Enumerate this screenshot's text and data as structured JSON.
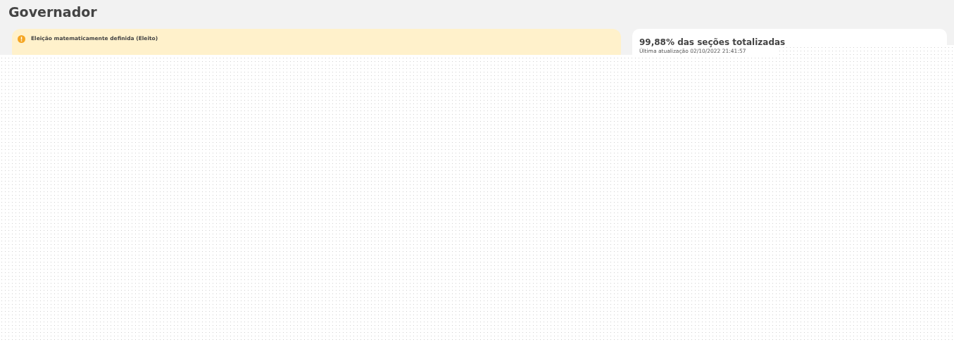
{
  "page_title": "Governador",
  "alert": {
    "kind": "warning",
    "text": "Eleição matematicamente definida (Eleito)"
  },
  "status_card": {
    "headline": "99,88% das seções totalizadas",
    "updated": "Última atualização 02/10/2022 21:41:57"
  }
}
